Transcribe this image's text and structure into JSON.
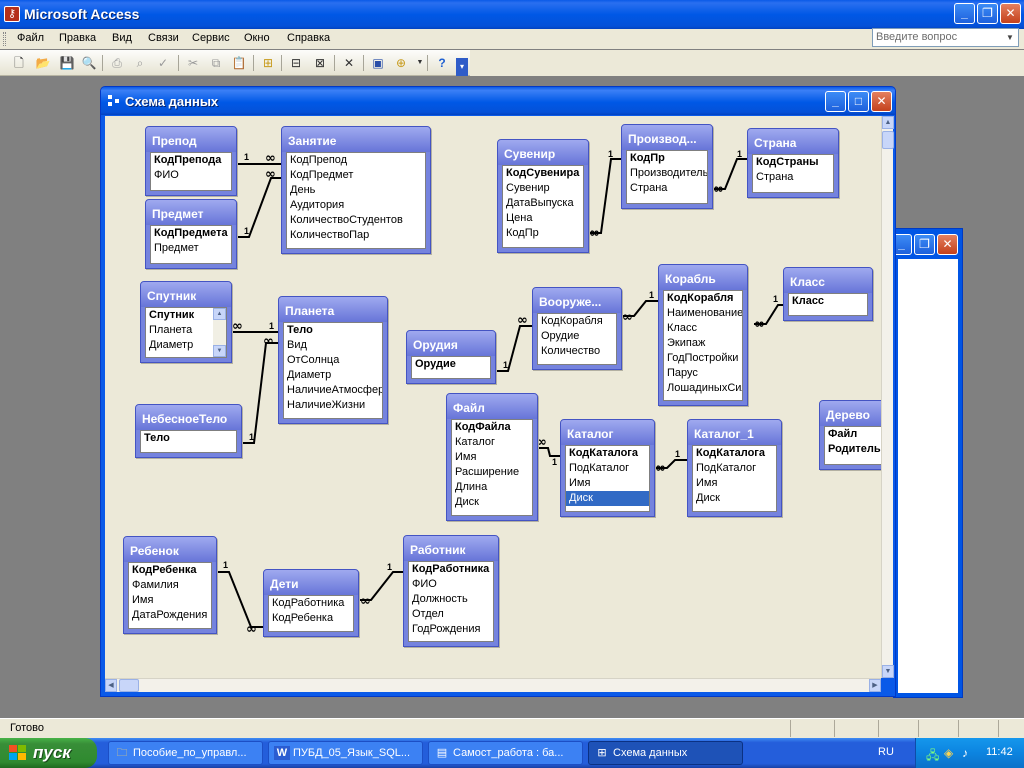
{
  "app": {
    "title": "Microsoft Access"
  },
  "menu": [
    "Файл",
    "Правка",
    "Вид",
    "Связи",
    "Сервис",
    "Окно",
    "Справка"
  ],
  "ask_placeholder": "Введите вопрос",
  "schema_window": {
    "title": "Схема данных"
  },
  "tables": {
    "prepod": {
      "title": "Препод",
      "fields": [
        "КодПреподa",
        "ФИО"
      ]
    },
    "zanyatie": {
      "title": "Занятие",
      "fields": [
        "КодПрепод",
        "КодПредмет",
        "День",
        "Аудитория",
        "КоличествоСтудентов",
        "КоличествоПар"
      ]
    },
    "predmet": {
      "title": "Предмет",
      "fields": [
        "КодПредмета",
        "Предмет"
      ]
    },
    "suvenir": {
      "title": "Сувенир",
      "fields": [
        "КодСувенира",
        "Сувенир",
        "ДатаВыпуска",
        "Цена",
        "КодПр"
      ]
    },
    "proizvod": {
      "title": "Производ...",
      "fields": [
        "КодПр",
        "Производитель",
        "Страна"
      ]
    },
    "strana": {
      "title": "Страна",
      "fields": [
        "КодСтраны",
        "Страна"
      ]
    },
    "sputnik": {
      "title": "Спутник",
      "fields": [
        "Спутник",
        "Планета",
        "Диаметр"
      ]
    },
    "planeta": {
      "title": "Планета",
      "fields": [
        "Тело",
        "Вид",
        "ОтСолнца",
        "Диаметр",
        "НаличиеАтмосферы",
        "НаличиеЖизни"
      ]
    },
    "nebesnoe": {
      "title": "НебесноеТело",
      "fields": [
        "Тело"
      ]
    },
    "orudie": {
      "title": "Орудия",
      "fields": [
        "Орудие"
      ]
    },
    "vooruzh": {
      "title": "Вооруже...",
      "fields": [
        "КодКорабля",
        "Орудие",
        "Количество"
      ]
    },
    "korabl": {
      "title": "Корабль",
      "fields": [
        "КодКорабля",
        "Наименование",
        "Класс",
        "Экипаж",
        "ГодПостройки",
        "Парус",
        "ЛошадиныхСил"
      ]
    },
    "klass": {
      "title": "Класс",
      "fields": [
        "Класс"
      ]
    },
    "fail": {
      "title": "Файл",
      "fields": [
        "КодФайла",
        "Каталог",
        "Имя",
        "Расширение",
        "Длина",
        "Диск"
      ]
    },
    "katalog": {
      "title": "Каталог",
      "fields": [
        "КодКаталога",
        "ПодКаталог",
        "Имя",
        "Диск"
      ]
    },
    "katalog1": {
      "title": "Каталог_1",
      "fields": [
        "КодКаталога",
        "ПодКаталог",
        "Имя",
        "Диск"
      ]
    },
    "derevo": {
      "title": "Дерево",
      "fields": [
        "Файл",
        "Родитель"
      ]
    },
    "rebenok": {
      "title": "Ребенок",
      "fields": [
        "КодРебенка",
        "Фамилия",
        "Имя",
        "ДатаРождения"
      ]
    },
    "deti": {
      "title": "Дети",
      "fields": [
        "КодРаботника",
        "КодРебенка"
      ]
    },
    "rabotnik": {
      "title": "Работник",
      "fields": [
        "КодРаботника",
        "ФИО",
        "Должность",
        "Отдел",
        "ГодРождения"
      ]
    }
  },
  "status": {
    "text": "Готово"
  },
  "taskbar": {
    "start": "пуск",
    "tasks": [
      "Пособие_по_управл...",
      "ПУБД_05_Язык_SQL...",
      "Самост_работа : ба...",
      "Схема данных"
    ],
    "lang": "RU",
    "clock": "11:42"
  },
  "colors": {
    "titlebar": "#0058e6",
    "table_header": "#7583de",
    "canvas": "#ece9d8",
    "taskbar": "#245edb",
    "start": "#388e38"
  }
}
